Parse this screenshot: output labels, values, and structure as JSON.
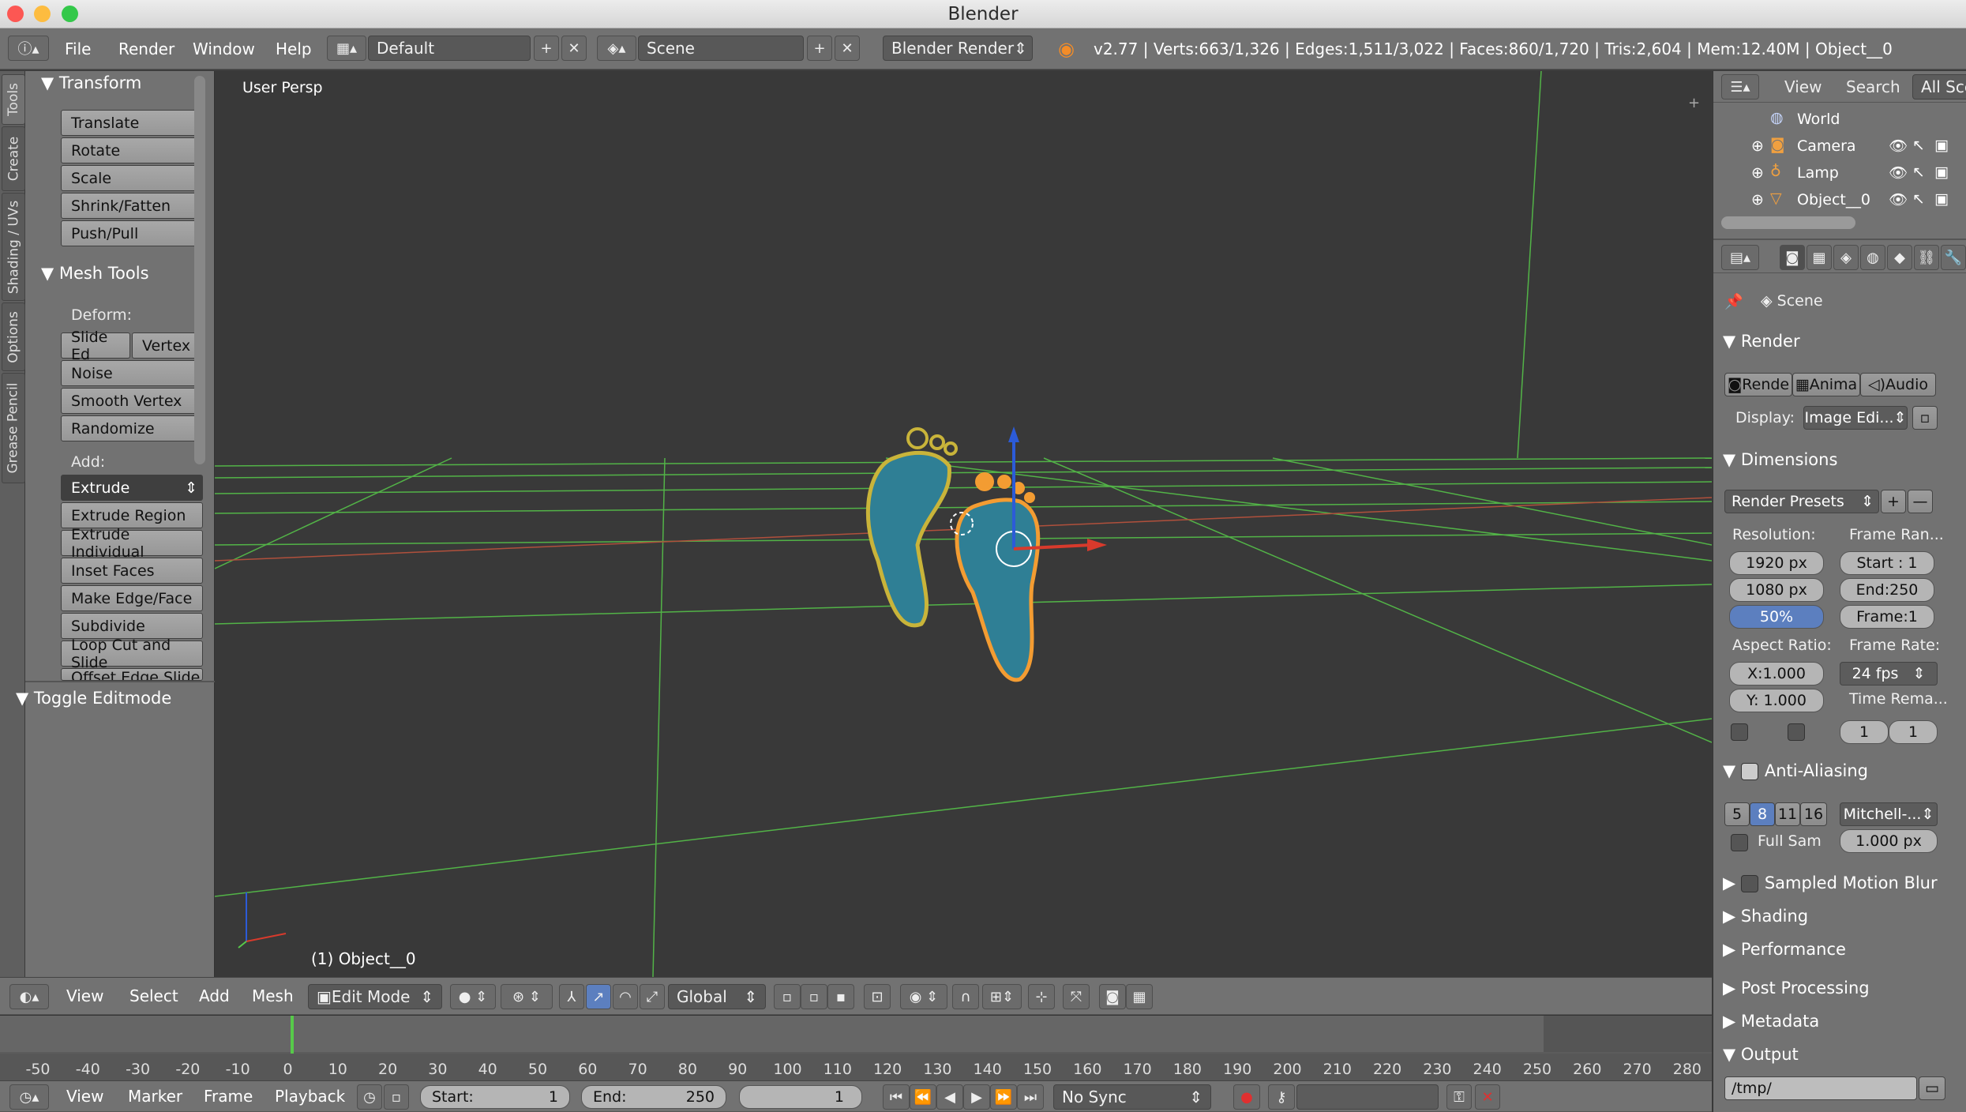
{
  "window": {
    "title": "Blender"
  },
  "info_header": {
    "menus": [
      "File",
      "Render",
      "Window",
      "Help"
    ],
    "layout": "Default",
    "scene": "Scene",
    "engine": "Blender Render",
    "stats": "v2.77 | Verts:663/1,326 | Edges:1,511/3,022 | Faces:860/1,720 | Tris:2,604 | Mem:12.40M | Object__0"
  },
  "tool_tabs": [
    "Tools",
    "Create",
    "Shading / UVs",
    "Options",
    "Grease Pencil"
  ],
  "toolshelf": {
    "transform": {
      "title": "Transform",
      "buttons": [
        "Translate",
        "Rotate",
        "Scale",
        "Shrink/Fatten",
        "Push/Pull"
      ]
    },
    "mesh_tools": {
      "title": "Mesh Tools",
      "deform_label": "Deform:",
      "slide_edge": "Slide Ed",
      "vertex": "Vertex",
      "deform_buttons": [
        "Noise",
        "Smooth Vertex",
        "Randomize"
      ],
      "add_label": "Add:",
      "extrude_select": "Extrude",
      "add_buttons": [
        "Extrude Region",
        "Extrude Individual",
        "Inset Faces",
        "Make Edge/Face",
        "Subdivide",
        "Loop Cut and Slide",
        "Offset Edge Slide"
      ]
    },
    "toggle_editmode": "Toggle Editmode"
  },
  "viewport": {
    "view_label": "User Persp",
    "object_label": "(1) Object__0"
  },
  "outliner": {
    "menus": [
      "View",
      "Search"
    ],
    "filter": "All Sce",
    "items": [
      "World",
      "Camera",
      "Lamp",
      "Object__0"
    ]
  },
  "properties": {
    "context": "Scene",
    "render": {
      "title": "Render",
      "buttons": [
        "Rende",
        "Anima",
        "Audio"
      ],
      "display_label": "Display:",
      "display_value": "Image Edi..."
    },
    "dimensions": {
      "title": "Dimensions",
      "presets": "Render Presets",
      "resolution_label": "Resolution:",
      "res_x": "1920 px",
      "res_y": "1080 px",
      "res_pct": "50%",
      "frame_range_label": "Frame Ran...",
      "start": "Start : 1",
      "end": "End:250",
      "frame": "Frame:1",
      "aspect_label": "Aspect Ratio:",
      "aspect_x": "X:1.000",
      "aspect_y": "Y: 1.000",
      "frame_rate_label": "Frame Rate:",
      "fps": "24 fps",
      "time_remap_label": "Time Rema...",
      "remap_old": "1",
      "remap_new": "1"
    },
    "anti_aliasing": {
      "title": "Anti-Aliasing",
      "samples": [
        "5",
        "8",
        "11",
        "16"
      ],
      "filter": "Mitchell-...",
      "full_sample": "Full Sam",
      "filter_size": "1.000 px"
    },
    "collapsed": [
      "Sampled Motion Blur",
      "Shading",
      "Performance",
      "Post Processing",
      "Metadata"
    ],
    "output": {
      "title": "Output",
      "path": "/tmp/"
    }
  },
  "view3d_header": {
    "menus": [
      "View",
      "Select",
      "Add",
      "Mesh"
    ],
    "mode": "Edit Mode",
    "orientation": "Global"
  },
  "timeline": {
    "ticks": [
      "-50",
      "-40",
      "-30",
      "-20",
      "-10",
      "0",
      "10",
      "20",
      "30",
      "40",
      "50",
      "60",
      "70",
      "80",
      "90",
      "100",
      "110",
      "120",
      "130",
      "140",
      "150",
      "160",
      "170",
      "180",
      "190",
      "200",
      "210",
      "220",
      "230",
      "240",
      "250",
      "260",
      "270",
      "280"
    ]
  },
  "timeline_header": {
    "menus": [
      "View",
      "Marker",
      "Frame",
      "Playback"
    ],
    "start": "Start:",
    "start_val": "1",
    "end": "End:",
    "end_val": "250",
    "current": "1",
    "sync": "No Sync"
  },
  "colors": {
    "header": "#727272",
    "viewport": "#393939",
    "grid": "#5bd44a",
    "selected": "#f39c32",
    "mesh": "#2f7f95"
  }
}
